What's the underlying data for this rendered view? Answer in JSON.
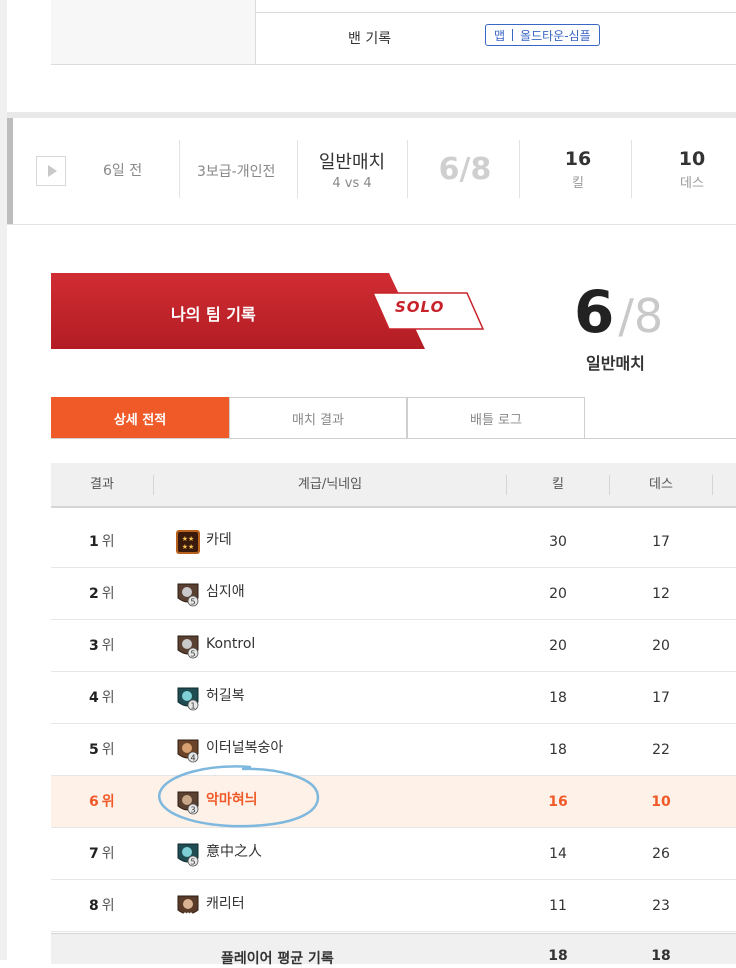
{
  "ban_record": {
    "label": "밴 기록",
    "map_prefix": "맵",
    "map_name": "올드타운-심플"
  },
  "match": {
    "when": "6일 전",
    "mode": "3보급-개인전",
    "type": "일반매치",
    "players": "4 vs 4",
    "rank": "6/8",
    "kills": "16",
    "kills_label": "킬",
    "deaths": "10",
    "deaths_label": "데스"
  },
  "team": {
    "title": "나의 팀 기록",
    "solo_tag": "SOLO",
    "rank": "6",
    "slash": "/",
    "total": "8",
    "match_type": "일반매치"
  },
  "tabs": [
    {
      "label": "상세 전적",
      "active": true
    },
    {
      "label": "매치 결과",
      "active": false
    },
    {
      "label": "배틀 로그",
      "active": false
    }
  ],
  "table": {
    "headers": {
      "result": "결과",
      "grade_nick": "계급/닉네임",
      "kills": "킬",
      "deaths": "데스"
    },
    "rank_unit": "위",
    "rows": [
      {
        "rank": "1",
        "nickname": "카데",
        "kills": "30",
        "deaths": "17",
        "icon": "gold-star-rank-icon"
      },
      {
        "rank": "2",
        "nickname": "심지애",
        "kills": "20",
        "deaths": "12",
        "icon": "rank-emblem-5-icon"
      },
      {
        "rank": "3",
        "nickname": "Kontrol",
        "kills": "20",
        "deaths": "20",
        "icon": "rank-emblem-5-icon"
      },
      {
        "rank": "4",
        "nickname": "허길복",
        "kills": "18",
        "deaths": "17",
        "icon": "teal-rank-emblem-1-icon"
      },
      {
        "rank": "5",
        "nickname": "이터널복숭아",
        "kills": "18",
        "deaths": "22",
        "icon": "rank-emblem-4-icon"
      },
      {
        "rank": "6",
        "nickname": "악마혀늬",
        "kills": "16",
        "deaths": "10",
        "icon": "rank-emblem-3-icon",
        "me": true
      },
      {
        "rank": "7",
        "nickname": "意中之人",
        "kills": "14",
        "deaths": "26",
        "icon": "teal-rank-emblem-5-icon"
      },
      {
        "rank": "8",
        "nickname": "캐리터",
        "kills": "11",
        "deaths": "23",
        "icon": "rank-emblem-dots-icon"
      }
    ],
    "average": {
      "label": "플레이어 평균 기록",
      "kills": "18",
      "deaths": "18"
    }
  },
  "colors": {
    "accent_orange": "#f05a28",
    "banner_red": "#c7222a",
    "map_badge_blue": "#3a66c4",
    "annotation_circle": "#7fb8de"
  }
}
